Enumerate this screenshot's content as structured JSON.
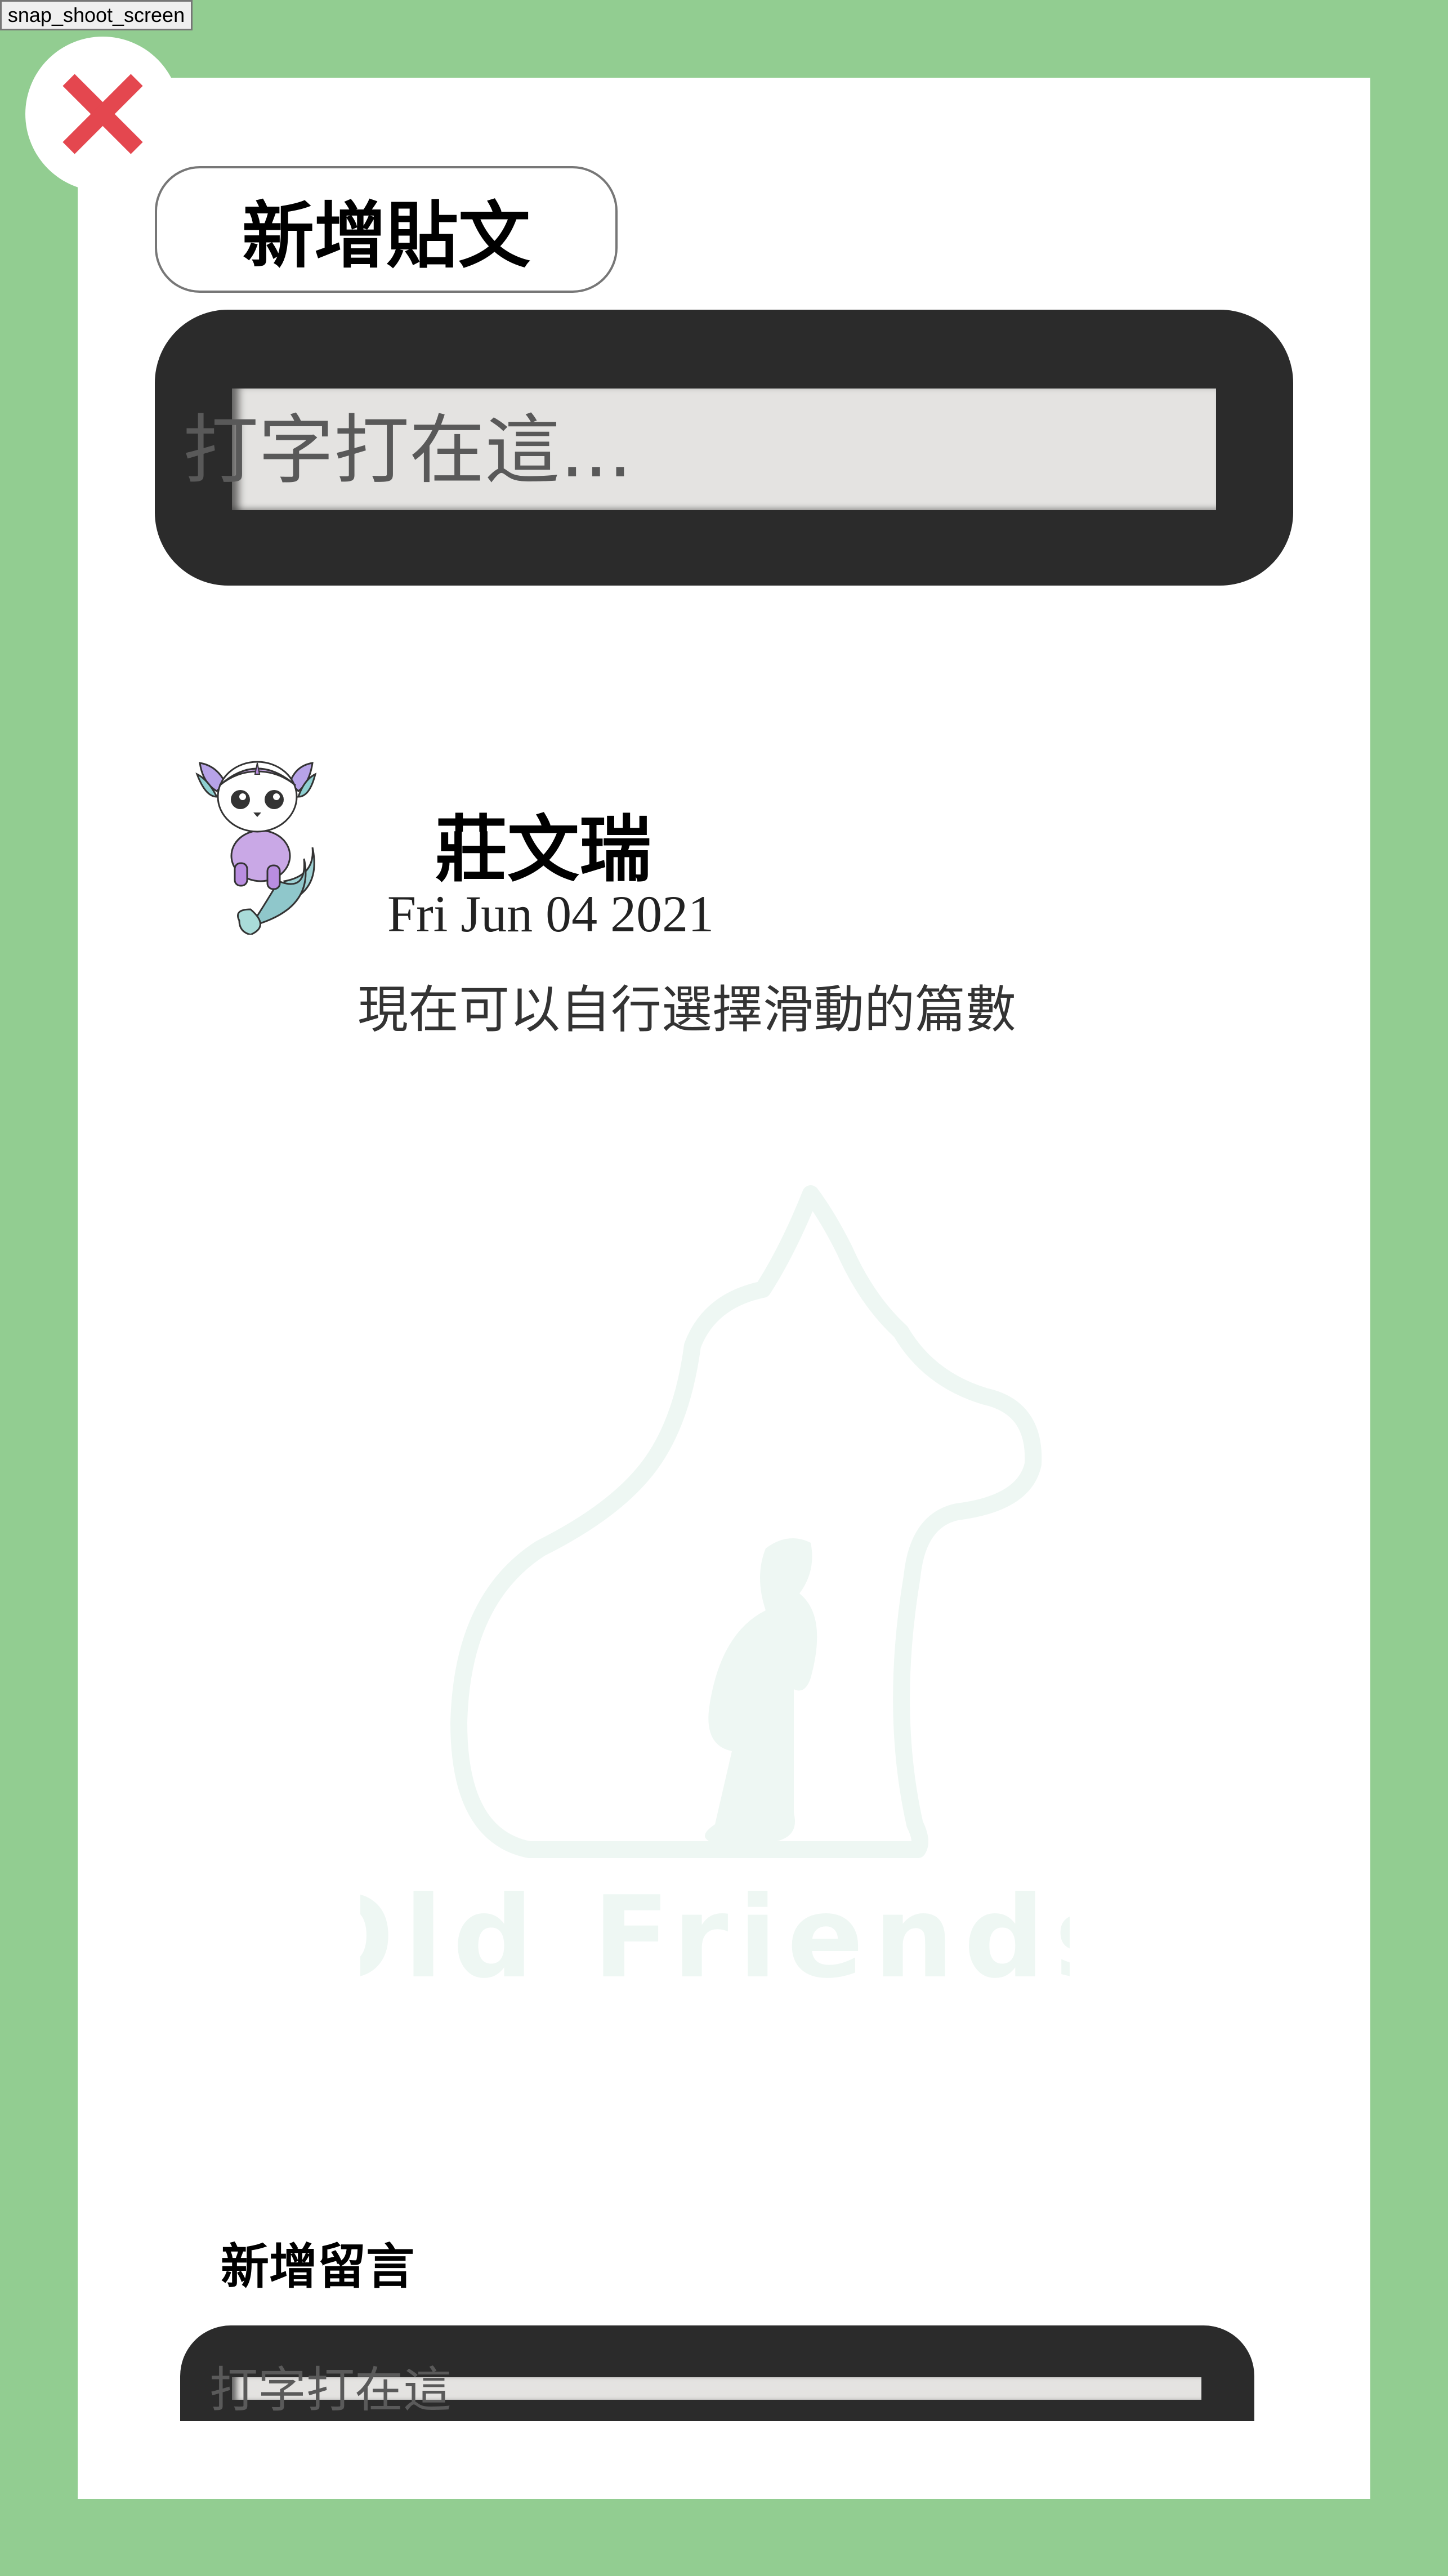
{
  "toolbar": {
    "snap_label": "snap_shoot_screen"
  },
  "header": {
    "title": "新增貼文"
  },
  "post_input": {
    "placeholder": "打字打在這..."
  },
  "post": {
    "author": "莊文瑞",
    "date": "Fri Jun 04 2021",
    "content": "現在可以自行選擇滑動的篇數"
  },
  "watermark": {
    "text": "Old Friends"
  },
  "comment": {
    "label": "新增留言",
    "placeholder": "打字打在這"
  },
  "colors": {
    "background": "#92cd91",
    "panel": "#ffffff",
    "input_frame": "#2b2b2b",
    "close_icon": "#e4474f",
    "watermark": "#eef7f3"
  },
  "icons": {
    "close": "close-icon",
    "avatar": "avatar-creature"
  }
}
